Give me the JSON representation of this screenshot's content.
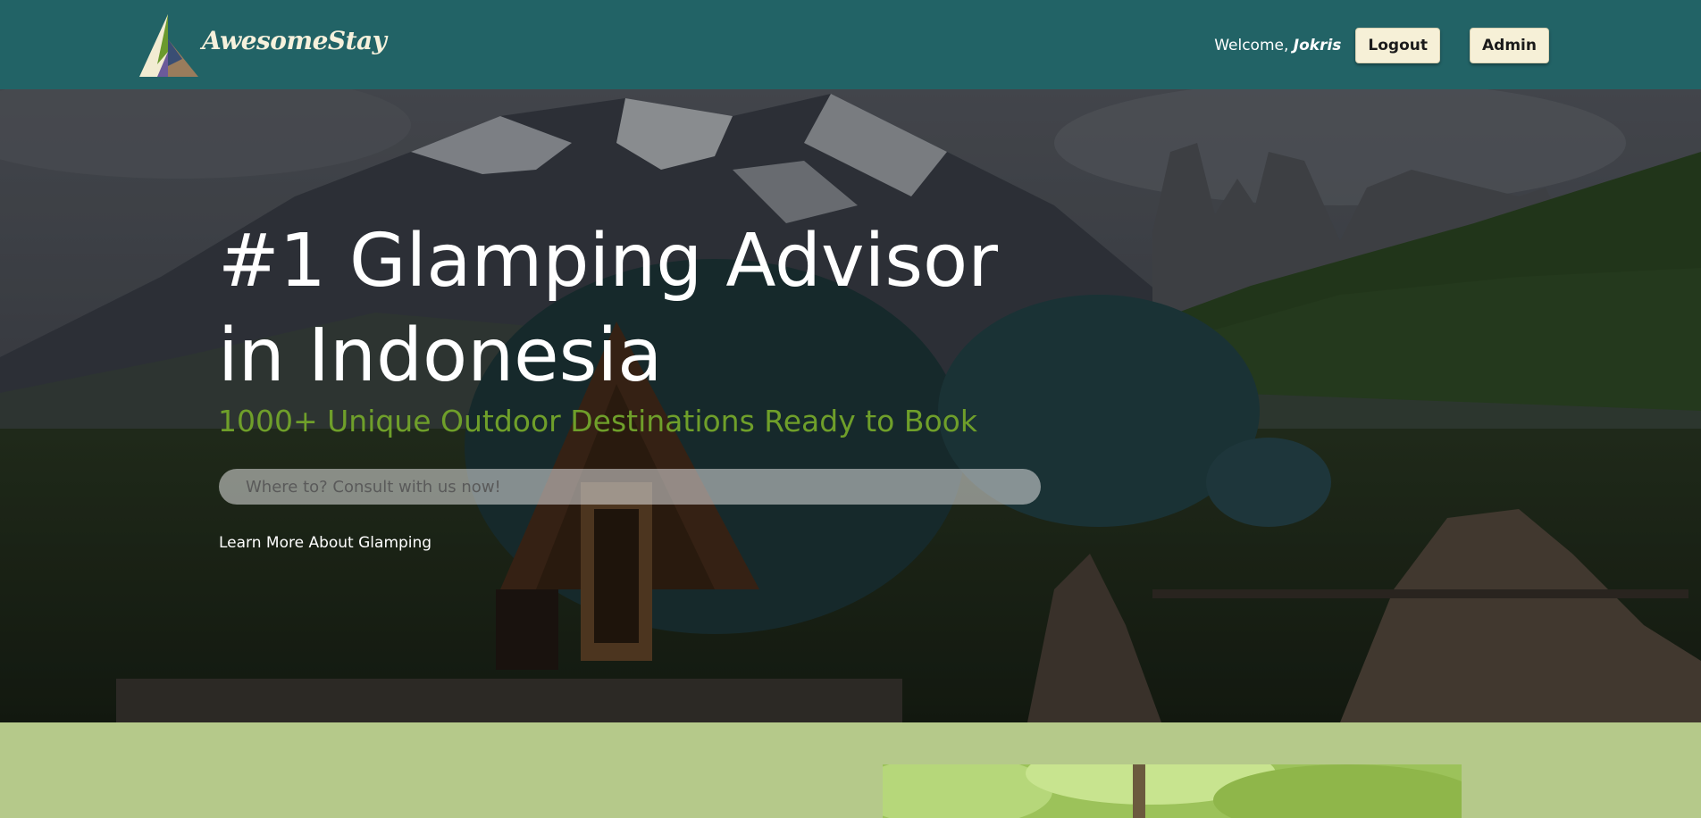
{
  "header": {
    "brand": "AwesomeStay",
    "welcome_prefix": "Welcome,",
    "username": "Jokris",
    "logout_label": "Logout",
    "admin_label": "Admin"
  },
  "hero": {
    "title_line1": "#1 Glamping Advisor",
    "title_line2": "in Indonesia",
    "subtitle": "1000+ Unique Outdoor Destinations Ready to Book",
    "search_placeholder": "Where to? Consult with us now!",
    "learn_more": "Learn More About Glamping"
  },
  "colors": {
    "header_bg": "#226366",
    "accent_green": "#6f9f2a",
    "button_bg": "#f6f0d7",
    "lower_bg": "#b5c98a"
  },
  "icons": {
    "logo": "mountain-logo-icon"
  }
}
